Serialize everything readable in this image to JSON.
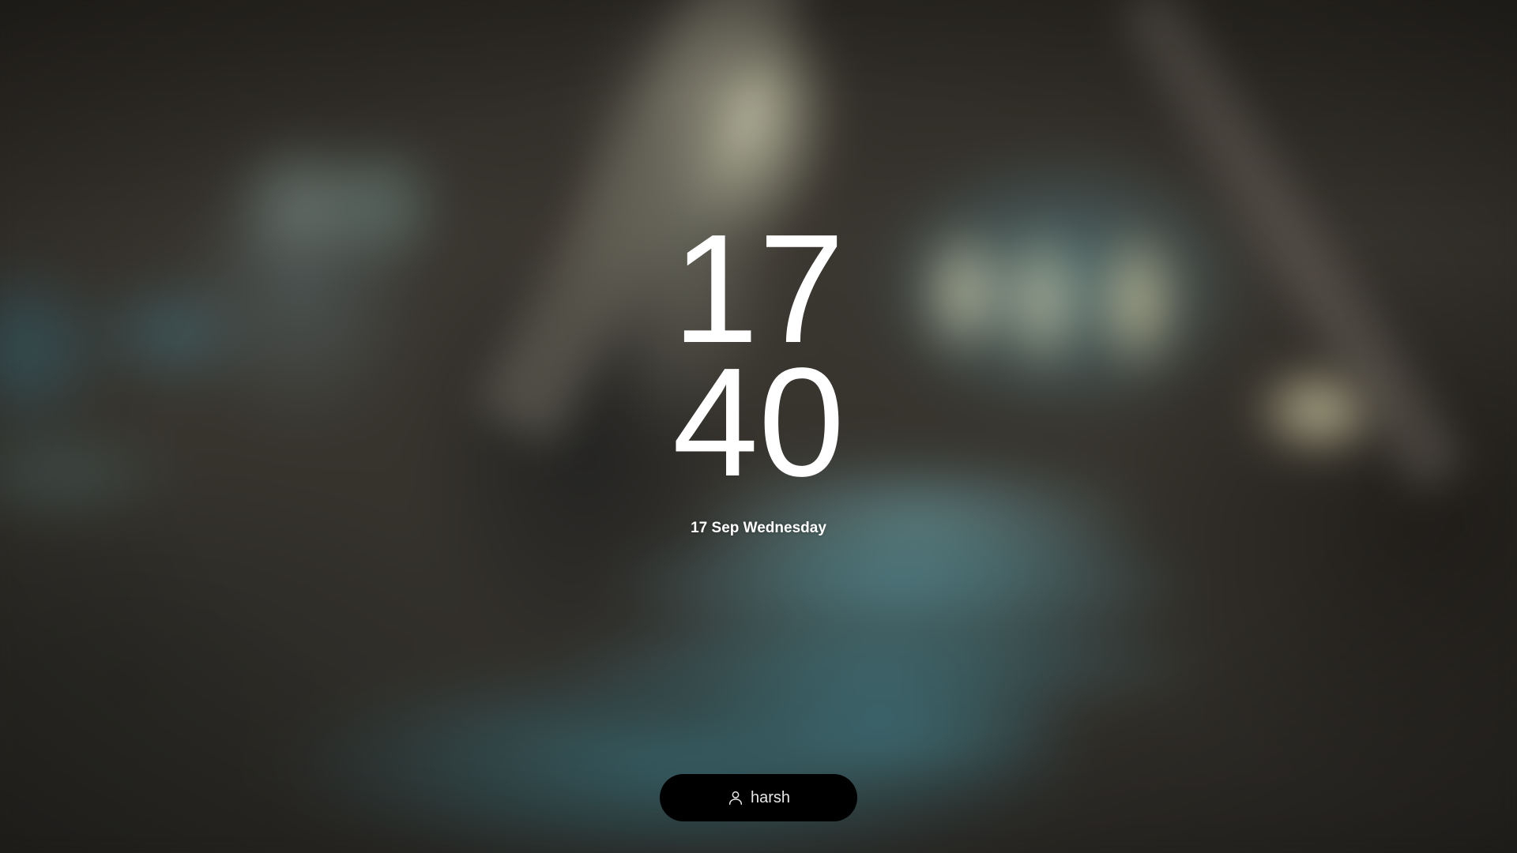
{
  "clock": {
    "hours": "17",
    "minutes": "40",
    "date": "17 Sep Wednesday"
  },
  "user": {
    "name": "harsh",
    "icon": "user-icon"
  },
  "colors": {
    "text": "#ffffff",
    "user_button_bg": "#000000"
  }
}
